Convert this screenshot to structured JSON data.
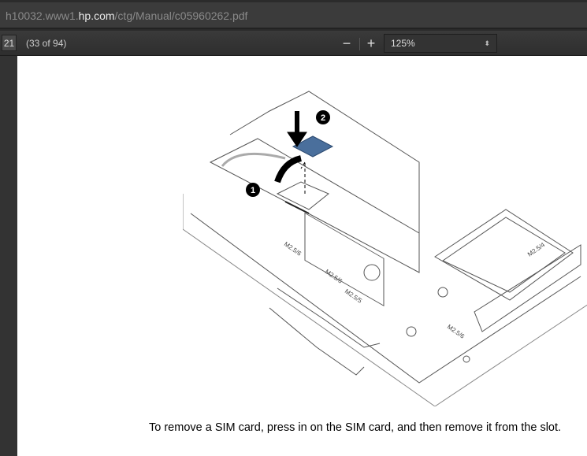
{
  "address_bar": {
    "url_prefix": "h10032.www1.",
    "url_domain": "hp.com",
    "url_path": "/ctg/Manual/c05960262.pdf"
  },
  "toolbar": {
    "page_number": "21",
    "page_count": "(33 of 94)",
    "zoom_out": "−",
    "zoom_in": "+",
    "zoom_level": "125%",
    "zoom_arrow": "⬍"
  },
  "document": {
    "caption": "To remove a SIM card, press in on the SIM card, and then remove it from the slot.",
    "callouts": [
      "1",
      "2"
    ],
    "screw_labels": [
      "M2.5/6",
      "M2.5/6",
      "M2.5/5",
      "M2.5/6",
      "M2.5/4"
    ],
    "sim_color": "#4a6f9c"
  }
}
